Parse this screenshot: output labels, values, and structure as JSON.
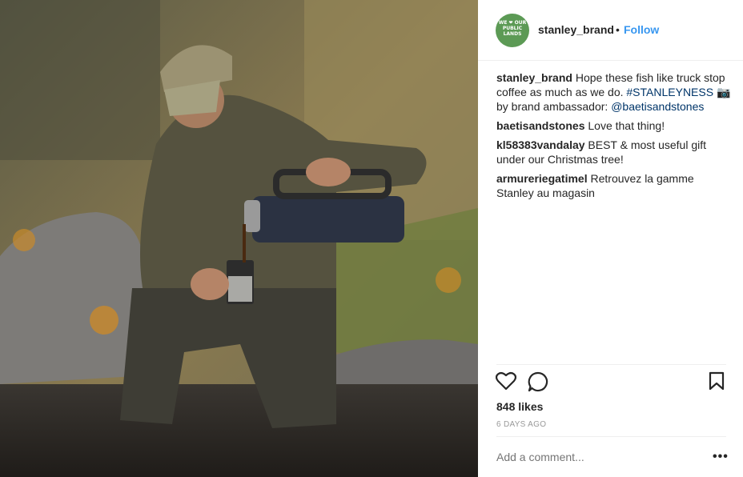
{
  "post": {
    "photo_icon": "photo-placeholder",
    "avatar_text": "WE ❤ OUR PUBLIC LANDS",
    "username": "stanley_brand",
    "separator": "•",
    "follow_label": "Follow"
  },
  "comments": [
    {
      "user": "stanley_brand",
      "text_1": "Hope these fish like truck stop coffee as much as we do.",
      "hashtag": "#STANLEYNESS",
      "camera_glyph": "📷",
      "text_2": "by brand ambassador:",
      "mention": "@baetisandstones"
    },
    {
      "user": "baetisandstones",
      "text": "Love that thing!"
    },
    {
      "user": "kl58383vandalay",
      "text": "BEST & most useful gift under our Christmas tree!"
    },
    {
      "user": "armureriegatimel",
      "text": "Retrouvez la gamme Stanley au magasin"
    }
  ],
  "actions": {
    "like_icon": "heart-icon",
    "comment_icon": "comment-icon",
    "save_icon": "bookmark-icon"
  },
  "likes_text": "848 likes",
  "date_text": "6 DAYS AGO",
  "add_comment_placeholder": "Add a comment...",
  "more_options": "•••",
  "colors": {
    "link": "#003569",
    "follow": "#3897f0",
    "muted": "#999999"
  }
}
